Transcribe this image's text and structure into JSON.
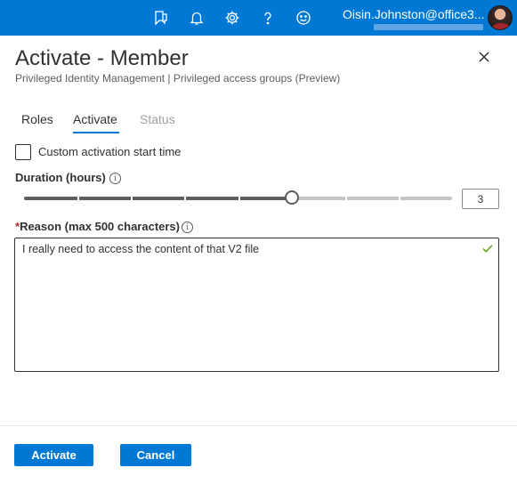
{
  "topbar": {
    "icons": [
      "feedback-icon",
      "bell-icon",
      "gear-icon",
      "help-icon",
      "smiley-icon"
    ],
    "account_name": "Oisin.Johnston@office3...",
    "accent": "#0078d4"
  },
  "header": {
    "title": "Activate - Member",
    "subtitle": "Privileged Identity Management | Privileged access groups (Preview)"
  },
  "tabs": [
    {
      "label": "Roles",
      "state": "normal"
    },
    {
      "label": "Activate",
      "state": "selected"
    },
    {
      "label": "Status",
      "state": "disabled"
    }
  ],
  "custom_start": {
    "label": "Custom activation start time",
    "checked": false
  },
  "duration": {
    "label": "Duration (hours)",
    "value": "3",
    "slider_fraction": 0.625
  },
  "reason": {
    "required_marker": "*",
    "label": "Reason (max 500 characters)",
    "value": "I really need to access the content of that V2 file"
  },
  "footer": {
    "activate_label": "Activate",
    "cancel_label": "Cancel"
  }
}
